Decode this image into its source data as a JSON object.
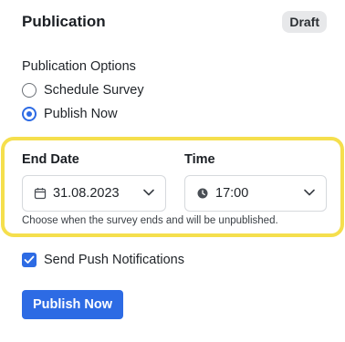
{
  "header": {
    "title": "Publication",
    "badge": "Draft"
  },
  "publication_options": {
    "label": "Publication Options",
    "options": [
      {
        "label": "Schedule Survey",
        "selected": false
      },
      {
        "label": "Publish Now",
        "selected": true
      }
    ]
  },
  "end_date": {
    "label": "End Date",
    "value": "31.08.2023",
    "icon": "calendar-icon"
  },
  "time": {
    "label": "Time",
    "value": "17:00",
    "icon": "clock-icon"
  },
  "hint": "Choose when the survey ends and will be unpublished.",
  "push": {
    "label": "Send Push Notifications",
    "checked": true
  },
  "actions": {
    "publish_label": "Publish Now"
  },
  "colors": {
    "accent": "#2d6be4",
    "highlight": "#f5df4d",
    "badge_bg": "#e7e8ea"
  }
}
